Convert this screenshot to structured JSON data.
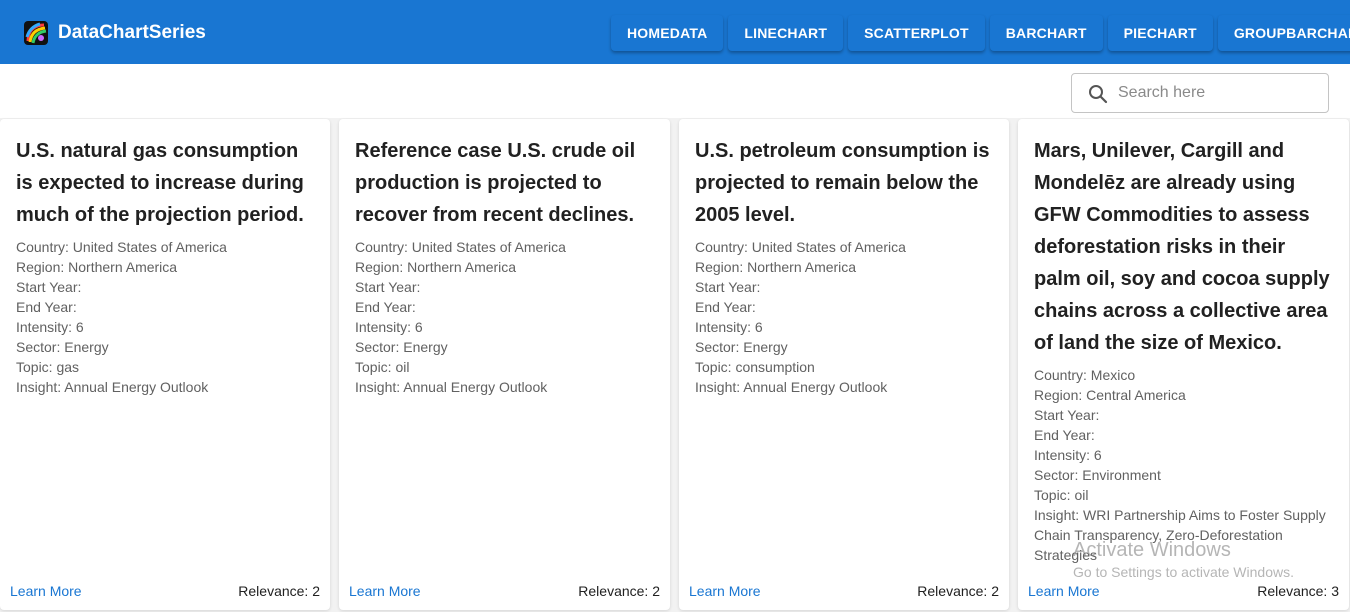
{
  "header": {
    "brand": "DataChartSeries",
    "nav": [
      "HOMEDATA",
      "LINECHART",
      "SCATTERPLOT",
      "BARCHART",
      "PIECHART",
      "GROUPBARCHART"
    ]
  },
  "search": {
    "placeholder": "Search here",
    "value": ""
  },
  "cards": [
    {
      "title": "U.S. natural gas consumption is expected to increase during much of the projection period.",
      "country": "Country: United States of America",
      "region": "Region: Northern America",
      "start_year": "Start Year:",
      "end_year": "End Year:",
      "intensity": "Intensity: 6",
      "sector": "Sector: Energy",
      "topic": "Topic: gas",
      "insight": "Insight: Annual Energy Outlook",
      "learn_more": "Learn More",
      "relevance": "Relevance: 2"
    },
    {
      "title": "Reference case U.S. crude oil production is projected to recover from recent declines.",
      "country": "Country: United States of America",
      "region": "Region: Northern America",
      "start_year": "Start Year:",
      "end_year": "End Year:",
      "intensity": "Intensity: 6",
      "sector": "Sector: Energy",
      "topic": "Topic: oil",
      "insight": "Insight: Annual Energy Outlook",
      "learn_more": "Learn More",
      "relevance": "Relevance: 2"
    },
    {
      "title": "U.S. petroleum consumption is projected to remain below the 2005 level.",
      "country": "Country: United States of America",
      "region": "Region: Northern America",
      "start_year": "Start Year:",
      "end_year": "End Year:",
      "intensity": "Intensity: 6",
      "sector": "Sector: Energy",
      "topic": "Topic: consumption",
      "insight": "Insight: Annual Energy Outlook",
      "learn_more": "Learn More",
      "relevance": "Relevance: 2"
    },
    {
      "title": "Mars, Unilever, Cargill and Mondelēz are already using GFW Commodities to assess deforestation risks in their palm oil, soy and cocoa supply chains across a collective area of land the size of Mexico.",
      "country": "Country: Mexico",
      "region": "Region: Central America",
      "start_year": "Start Year:",
      "end_year": "End Year:",
      "intensity": "Intensity: 6",
      "sector": "Sector: Environment",
      "topic": "Topic: oil",
      "insight": "Insight: WRI Partnership Aims to Foster Supply Chain Transparency, Zero-Deforestation Strategies",
      "learn_more": "Learn More",
      "relevance": "Relevance: 3"
    }
  ],
  "watermark": {
    "line1": "Activate Windows",
    "line2": "Go to Settings to activate Windows."
  },
  "colors": {
    "primary": "#1976d2",
    "background": "#f2f2f2",
    "card": "#ffffff"
  }
}
